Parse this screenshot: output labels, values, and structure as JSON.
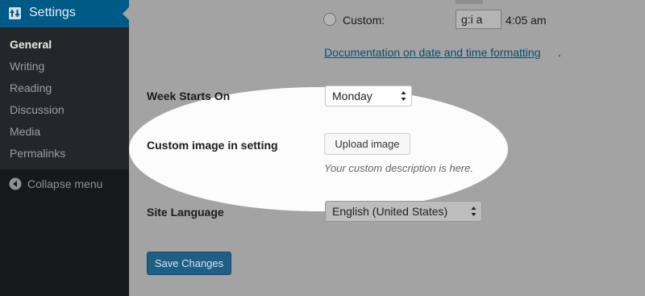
{
  "sidebar": {
    "header_title": "Settings",
    "items": [
      {
        "label": "General",
        "current": true
      },
      {
        "label": "Writing",
        "current": false
      },
      {
        "label": "Reading",
        "current": false
      },
      {
        "label": "Discussion",
        "current": false
      },
      {
        "label": "Media",
        "current": false
      },
      {
        "label": "Permalinks",
        "current": false
      }
    ],
    "collapse_label": "Collapse menu"
  },
  "time_format": {
    "custom_label": "Custom:",
    "custom_value": "g:i a",
    "preview": "4:05 am",
    "doc_link": "Documentation on date and time formatting",
    "doc_link_suffix": "."
  },
  "week_starts_on": {
    "label": "Week Starts On",
    "value": "Monday"
  },
  "custom_image": {
    "label": "Custom image in setting",
    "button_label": "Upload image",
    "description": "Your custom description is here."
  },
  "site_language": {
    "label": "Site Language",
    "value": "English (United States)"
  },
  "save_label": "Save Changes",
  "colors": {
    "sidebar_bg": "#16191c",
    "submenu_bg": "#23262a",
    "active_header": "#005a87",
    "primary_button": "#1f5f86",
    "overlay": "#a3a3a3",
    "spotlight": "#fcfcfc"
  }
}
